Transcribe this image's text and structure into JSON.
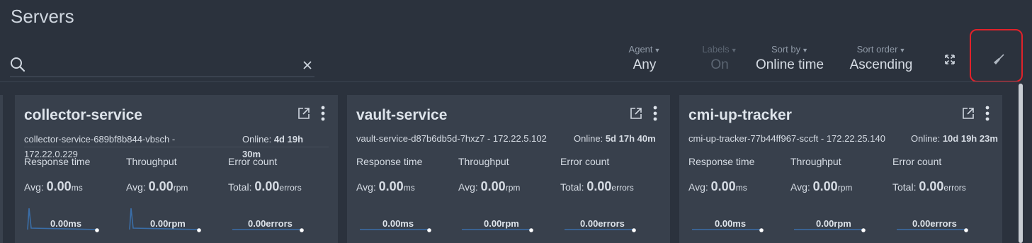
{
  "page": {
    "title": "Servers"
  },
  "search": {
    "value": "",
    "placeholder": ""
  },
  "filters": [
    {
      "label": "Agent",
      "value": "Any",
      "disabled": false
    },
    {
      "label": "Labels",
      "value": "On",
      "disabled": true
    },
    {
      "label": "Sort by",
      "value": "Online time",
      "disabled": false
    },
    {
      "label": "Sort order",
      "value": "Ascending",
      "disabled": false
    }
  ],
  "icons": {
    "search": "search-icon",
    "clear": "close-icon",
    "expand": "expand-icon",
    "broom": "broom-icon",
    "open": "open-in-new-icon",
    "menu": "more-vertical-icon",
    "caret": "caret-down-icon"
  },
  "colors": {
    "background": "#2b323d",
    "card": "#38404c",
    "spark": "#3a6ea8",
    "highlight": "#e0222a"
  },
  "metric_headers": {
    "response": "Response time",
    "throughput": "Throughput",
    "errors": "Error count"
  },
  "metric_prefixes": {
    "avg": "Avg:",
    "total": "Total:"
  },
  "cards": [
    {
      "name": "collector-service",
      "pod": "collector-service-689bf8b844-vbsch - 172.22.0.229",
      "online_label": "Online:",
      "online_value": "4d 19h 30m",
      "response": {
        "value": "0.00",
        "unit": "ms",
        "spark": "0.00ms"
      },
      "throughput": {
        "value": "0.00",
        "unit": "rpm",
        "spark": "0.00rpm"
      },
      "errors": {
        "value": "0.00",
        "unit": "errors",
        "spark": "0.00errors"
      }
    },
    {
      "name": "vault-service",
      "pod": "vault-service-d87b6db5d-7hxz7 - 172.22.5.102",
      "online_label": "Online:",
      "online_value": "5d 17h 40m",
      "response": {
        "value": "0.00",
        "unit": "ms",
        "spark": "0.00ms"
      },
      "throughput": {
        "value": "0.00",
        "unit": "rpm",
        "spark": "0.00rpm"
      },
      "errors": {
        "value": "0.00",
        "unit": "errors",
        "spark": "0.00errors"
      }
    },
    {
      "name": "cmi-up-tracker",
      "pod": "cmi-up-tracker-77b44ff967-sccft - 172.22.25.140",
      "online_label": "Online:",
      "online_value": "10d 19h 23m",
      "response": {
        "value": "0.00",
        "unit": "ms",
        "spark": "0.00ms"
      },
      "throughput": {
        "value": "0.00",
        "unit": "rpm",
        "spark": "0.00rpm"
      },
      "errors": {
        "value": "0.00",
        "unit": "errors",
        "spark": "0.00errors"
      }
    }
  ]
}
